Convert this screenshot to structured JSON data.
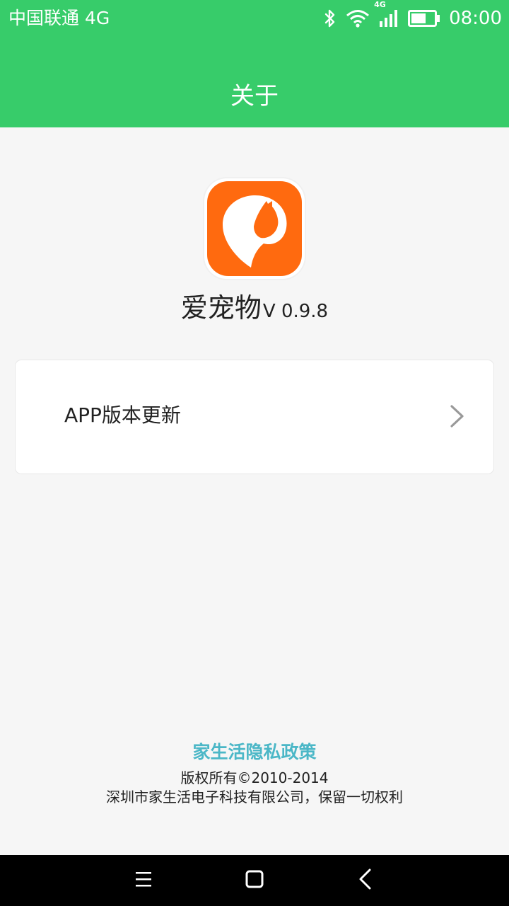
{
  "status_bar": {
    "carrier": "中国联通 4G",
    "network_label": "4G",
    "time": "08:00"
  },
  "header": {
    "title": "关于"
  },
  "app": {
    "name": "爱宠物",
    "version": "V 0.9.8",
    "logo_color": "#ff6a0f"
  },
  "settings": {
    "items": [
      {
        "label": "APP版本更新",
        "icon": "chevron-right-icon"
      }
    ]
  },
  "footer": {
    "privacy_link": "家生活隐私政策",
    "copyright": "版权所有©2010-2014",
    "company": "深圳市家生活电子科技有限公司，保留一切权利"
  },
  "nav_bar": {
    "buttons": [
      "menu-icon",
      "home-icon",
      "back-icon"
    ]
  },
  "colors": {
    "header_green": "#37cc6a",
    "link_teal": "#4bb7c7",
    "background": "#f6f6f6"
  }
}
